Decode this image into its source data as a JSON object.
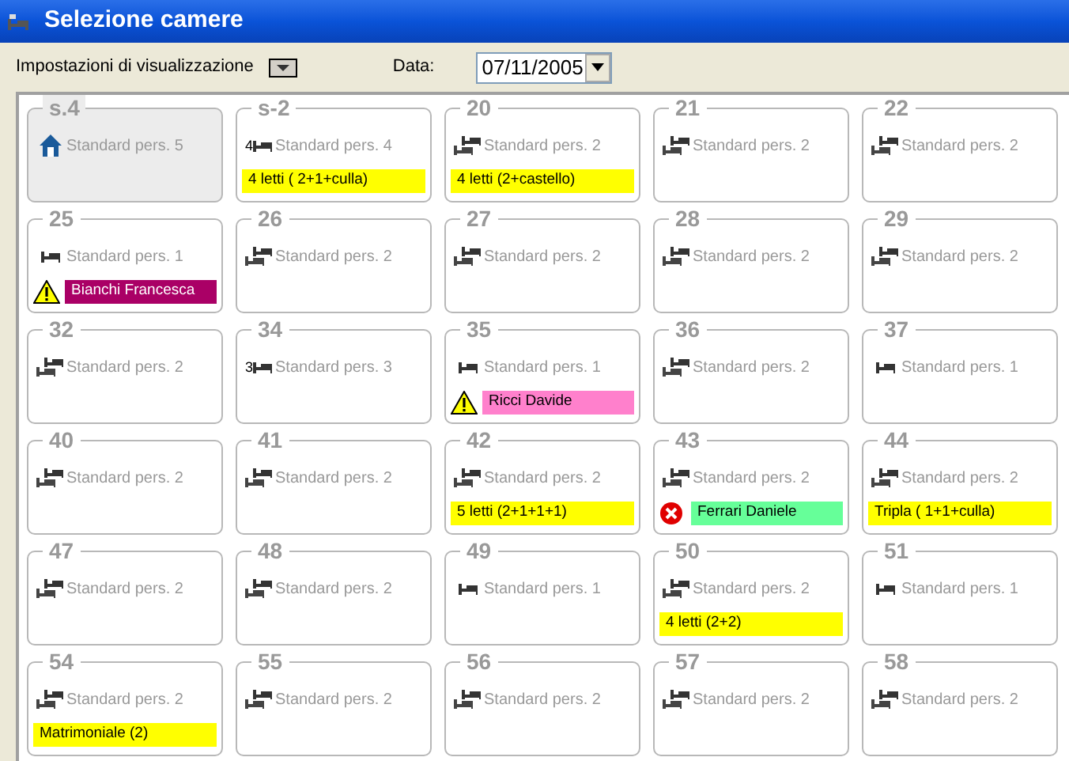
{
  "window": {
    "title": "Selezione camere"
  },
  "toolbar": {
    "settings_label": "Impostazioni di visualizzazione",
    "date_label": "Data:",
    "date_value": "07/11/2005"
  },
  "rooms": [
    {
      "number": "s.4",
      "type": "Standard pers. 5",
      "kind": "house",
      "selected": true
    },
    {
      "number": "s-2",
      "type": "Standard pers. 4",
      "kind": "single",
      "prefix": "4",
      "selected": false,
      "band": {
        "text": "4 letti ( 2+1+culla)",
        "color": "#ffff00"
      }
    },
    {
      "number": "20",
      "type": "Standard pers. 2",
      "kind": "double",
      "selected": false,
      "band": {
        "text": "4 letti (2+castello)",
        "color": "#ffff00"
      }
    },
    {
      "number": "21",
      "type": "Standard pers. 2",
      "kind": "double",
      "selected": false
    },
    {
      "number": "22",
      "type": "Standard pers. 2",
      "kind": "double",
      "selected": false
    },
    {
      "number": "25",
      "type": "Standard pers. 1",
      "kind": "single",
      "selected": false,
      "band": {
        "text": "Bianchi Francesca",
        "color": "#aa0066",
        "kind": "warning"
      }
    },
    {
      "number": "26",
      "type": "Standard pers. 2",
      "kind": "double",
      "selected": false
    },
    {
      "number": "27",
      "type": "Standard pers. 2",
      "kind": "double",
      "selected": false
    },
    {
      "number": "28",
      "type": "Standard pers. 2",
      "kind": "double",
      "selected": false
    },
    {
      "number": "29",
      "type": "Standard pers. 2",
      "kind": "double",
      "selected": false
    },
    {
      "number": "32",
      "type": "Standard pers. 2",
      "kind": "double",
      "selected": false
    },
    {
      "number": "34",
      "type": "Standard pers. 3",
      "kind": "single",
      "prefix": "3",
      "selected": false
    },
    {
      "number": "35",
      "type": "Standard pers. 1",
      "kind": "single",
      "selected": false,
      "band": {
        "text": "Ricci Davide",
        "color": "#ff80cc",
        "kind": "warning"
      }
    },
    {
      "number": "36",
      "type": "Standard pers. 2",
      "kind": "double",
      "selected": false
    },
    {
      "number": "37",
      "type": "Standard pers. 1",
      "kind": "single",
      "selected": false
    },
    {
      "number": "40",
      "type": "Standard pers. 2",
      "kind": "double",
      "selected": false
    },
    {
      "number": "41",
      "type": "Standard pers. 2",
      "kind": "double",
      "selected": false
    },
    {
      "number": "42",
      "type": "Standard pers. 2",
      "kind": "double",
      "selected": false,
      "band": {
        "text": "5 letti (2+1+1+1)",
        "color": "#ffff00"
      }
    },
    {
      "number": "43",
      "type": "Standard pers. 2",
      "kind": "double",
      "selected": false,
      "band": {
        "text": "Ferrari Daniele",
        "color": "#66ff99",
        "kind": "error"
      }
    },
    {
      "number": "44",
      "type": "Standard pers. 2",
      "kind": "double",
      "selected": false,
      "band": {
        "text": "Tripla ( 1+1+culla)",
        "color": "#ffff00"
      }
    },
    {
      "number": "47",
      "type": "Standard pers. 2",
      "kind": "double",
      "selected": false
    },
    {
      "number": "48",
      "type": "Standard pers. 2",
      "kind": "double",
      "selected": false
    },
    {
      "number": "49",
      "type": "Standard pers. 1",
      "kind": "single",
      "selected": false
    },
    {
      "number": "50",
      "type": "Standard pers. 2",
      "kind": "double",
      "selected": false,
      "band": {
        "text": "4 letti (2+2)",
        "color": "#ffff00"
      }
    },
    {
      "number": "51",
      "type": "Standard pers. 1",
      "kind": "single",
      "selected": false
    },
    {
      "number": "54",
      "type": "Standard pers. 2",
      "kind": "double",
      "selected": false,
      "band": {
        "text": "Matrimoniale (2)",
        "color": "#ffff00"
      }
    },
    {
      "number": "55",
      "type": "Standard pers. 2",
      "kind": "double",
      "selected": false
    },
    {
      "number": "56",
      "type": "Standard pers. 2",
      "kind": "double",
      "selected": false
    },
    {
      "number": "57",
      "type": "Standard pers. 2",
      "kind": "double",
      "selected": false
    },
    {
      "number": "58",
      "type": "Standard pers. 2",
      "kind": "double",
      "selected": false
    }
  ]
}
